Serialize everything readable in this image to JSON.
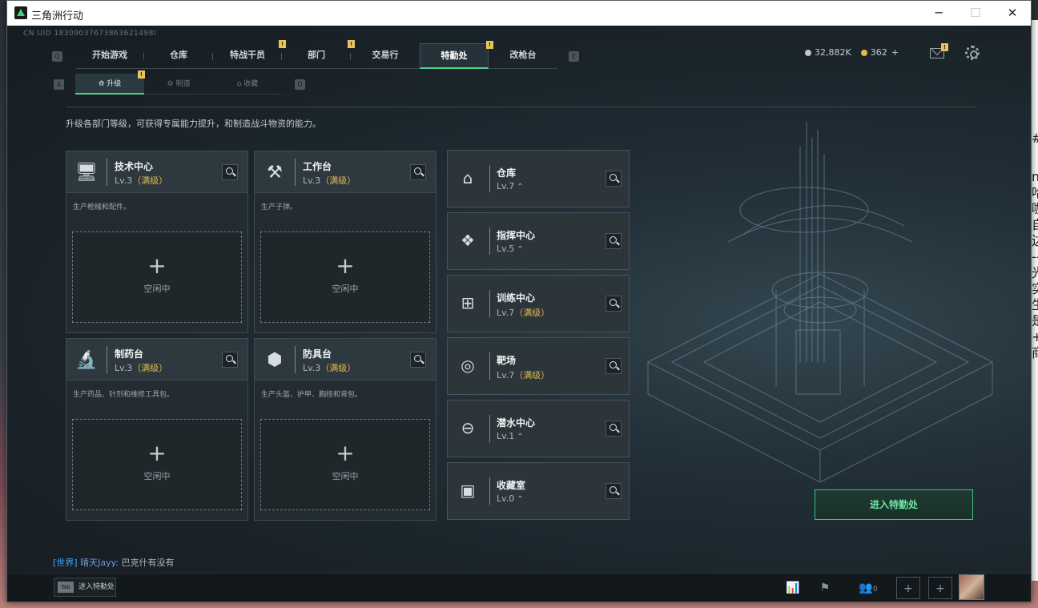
{
  "window": {
    "title": "三角洲行动",
    "minimize": "─",
    "maximize": "☐",
    "close": "✕"
  },
  "uid": "CN UID 18309037673863621498I",
  "main_tabs": {
    "key_left": "Q",
    "key_right": "E",
    "items": [
      {
        "label": "开始游戏",
        "badge": ""
      },
      {
        "label": "仓库",
        "badge": ""
      },
      {
        "label": "特战干员",
        "badge": "!"
      },
      {
        "label": "部门",
        "badge": "!"
      },
      {
        "label": "交易行",
        "badge": ""
      },
      {
        "label": "特勤处",
        "badge": "!",
        "active": true
      },
      {
        "label": "改枪台",
        "badge": ""
      }
    ]
  },
  "currency": {
    "coin1": "32,882K",
    "coin2": "362",
    "add": "+",
    "coin1_color": "#c0c6c9",
    "coin2_color": "#e0b84e"
  },
  "mail_badge": "!",
  "sub_tabs": {
    "key_left": "A",
    "key_right": "D",
    "items": [
      {
        "label": "升级",
        "icon": "upgrade-icon",
        "badge": "!",
        "active": true
      },
      {
        "label": "制造",
        "icon": "craft-icon"
      },
      {
        "label": "收藏",
        "icon": "collect-icon"
      }
    ]
  },
  "description": "升级各部门等级，可获得专属能力提升，和制造战斗物资的能力。",
  "production": [
    {
      "name": "技术中心",
      "level": "Lv.3",
      "max": "（满级）",
      "desc": "生产枪械和配件。",
      "icon": "tech-center-icon",
      "glyph": "🖥",
      "status": "空闲中"
    },
    {
      "name": "工作台",
      "level": "Lv.3",
      "max": "（满级）",
      "desc": "生产子弹。",
      "icon": "workbench-icon",
      "glyph": "⚒",
      "status": "空闲中"
    },
    {
      "name": "制药台",
      "level": "Lv.3",
      "max": "（满级）",
      "desc": "生产药品、针剂和维修工具包。",
      "icon": "pharmacy-icon",
      "glyph": "🔬",
      "status": "空闲中"
    },
    {
      "name": "防具台",
      "level": "Lv.3",
      "max": "（满级）",
      "desc": "生产头盔、护甲、胸挂和背包。",
      "icon": "armor-bench-icon",
      "glyph": "⬢",
      "status": "空闲中"
    }
  ],
  "facilities": [
    {
      "name": "仓库",
      "level": "Lv.7",
      "max": "",
      "up": "⌃",
      "icon": "warehouse-icon",
      "glyph": "⌂"
    },
    {
      "name": "指挥中心",
      "level": "Lv.5",
      "max": "",
      "up": "⌃",
      "icon": "command-center-icon",
      "glyph": "❖"
    },
    {
      "name": "训练中心",
      "level": "Lv.7",
      "max": "（满级）",
      "up": "",
      "icon": "training-center-icon",
      "glyph": "⊞"
    },
    {
      "name": "靶场",
      "level": "Lv.7",
      "max": "（满级）",
      "up": "",
      "icon": "range-icon",
      "glyph": "◎"
    },
    {
      "name": "潜水中心",
      "level": "Lv.1",
      "max": "",
      "up": "⌃",
      "icon": "dive-center-icon",
      "glyph": "⊖"
    },
    {
      "name": "收藏室",
      "level": "Lv.0",
      "max": "",
      "up": "⌃",
      "icon": "collection-room-icon",
      "glyph": "▣"
    }
  ],
  "enter_button": "进入特勤处",
  "chat": {
    "channel": "[世界]",
    "user": "晴天Jayy:",
    "message": "巴克什有没有"
  },
  "bottom": {
    "tab_key": "Tab",
    "tab_label": "进入特勤处",
    "friends_count": "0"
  },
  "bg_window_chars": [
    "#",
    "m",
    "哈",
    "咖",
    "自",
    "边",
    "--",
    "光",
    "实",
    "生",
    "是",
    "+",
    "商"
  ]
}
